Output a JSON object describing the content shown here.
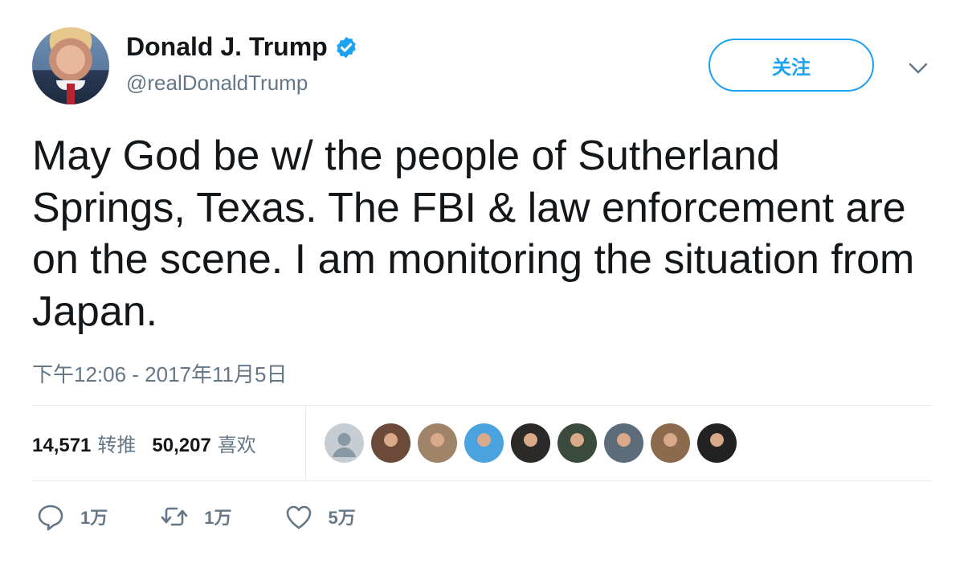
{
  "user": {
    "display_name": "Donald J. Trump",
    "handle": "@realDonaldTrump",
    "verified": true,
    "avatar_icon": "avatar-photo"
  },
  "follow_button": {
    "label": "关注"
  },
  "menu_caret_icon": "chevron-down-icon",
  "tweet": {
    "text": "May God be w/ the people of Sutherland Springs, Texas. The FBI & law enforcement are on the scene. I am monitoring the situation from Japan.",
    "timestamp": "下午12:06 - 2017年11月5日"
  },
  "stats": {
    "retweets_count": "14,571",
    "retweets_label": "转推",
    "likes_count": "50,207",
    "likes_label": "喜欢"
  },
  "likers": [
    {
      "icon": "default-avatar-icon",
      "color": "#c6cdd3"
    },
    {
      "icon": "liker-avatar",
      "color": "#6b4a3a"
    },
    {
      "icon": "liker-avatar",
      "color": "#a0846a"
    },
    {
      "icon": "liker-avatar",
      "color": "#4aa3df"
    },
    {
      "icon": "liker-avatar",
      "color": "#2b2a28"
    },
    {
      "icon": "liker-avatar",
      "color": "#3a4a3c"
    },
    {
      "icon": "liker-avatar",
      "color": "#5d6c7a"
    },
    {
      "icon": "liker-avatar",
      "color": "#8c6a4d"
    },
    {
      "icon": "liker-avatar",
      "color": "#222222"
    }
  ],
  "actions": {
    "reply_count": "1万",
    "retweet_count": "1万",
    "like_count": "5万"
  },
  "colors": {
    "accent": "#1da1f2",
    "secondary_text": "#657786",
    "divider": "#e6ecf0"
  }
}
